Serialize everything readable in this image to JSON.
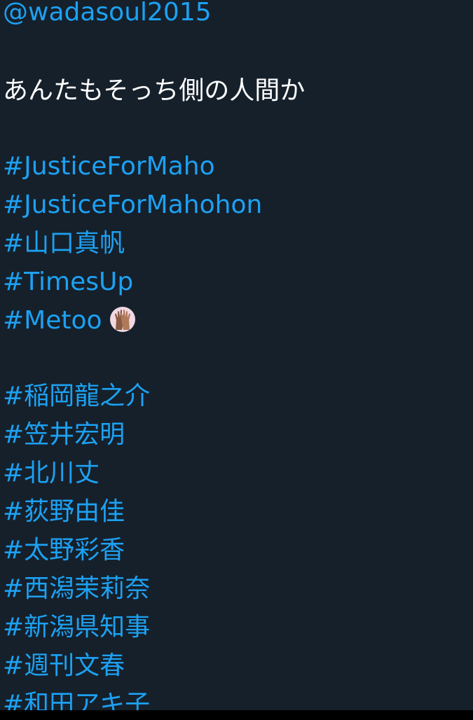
{
  "tweet": {
    "mention": "@wadasoul2015",
    "text": "あんたもそっち側の人間か",
    "hashtags_group1": [
      "#JusticeForMaho",
      "#JusticeForMahohon",
      "#山口真帆",
      "#TimesUp",
      "#Metoo"
    ],
    "hashtags_group2": [
      "#稲岡龍之介",
      "#笠井宏明",
      "#北川丈",
      "#荻野由佳",
      "#太野彩香",
      "#西潟茉莉奈",
      "#新潟県知事",
      "#週刊文春",
      "#和田アキ子"
    ],
    "emoji": "raised-hands-emoji"
  },
  "colors": {
    "background": "#15202b",
    "link": "#1da1f2",
    "text": "#ffffff",
    "bottom_bar": "#000000"
  }
}
